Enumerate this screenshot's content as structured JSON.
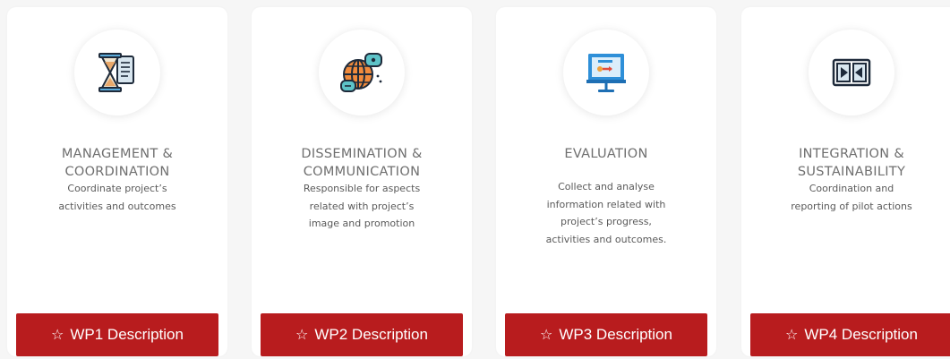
{
  "cards": [
    {
      "title": "MANAGEMENT &\nCOORDINATION",
      "title_line1": "MANAGEMENT &",
      "title_line2": "COORDINATION",
      "desc_line1": "Coordinate project’s",
      "desc_line2": "activities and outcomes",
      "button_label": "WP1 Description",
      "icon": "hourglass-document-icon"
    },
    {
      "title_line1": "DISSEMINATION &",
      "title_line2": "COMMUNICATION",
      "desc_line1": "Responsible for aspects",
      "desc_line2": "related with project’s",
      "desc_line3": "image and promotion",
      "button_label": "WP2 Description",
      "icon": "globe-chat-icon"
    },
    {
      "title_line1": "EVALUATION",
      "desc_line1": "Collect and analyse",
      "desc_line2": "information related with",
      "desc_line3": "project’s progress,",
      "desc_line4": "activities and outcomes.",
      "button_label": "WP3 Description",
      "icon": "presentation-board-icon"
    },
    {
      "title_line1": "INTEGRATION &",
      "title_line2": "SUSTAINABILITY",
      "desc_line1": "Coordination and",
      "desc_line2": "reporting of pilot actions",
      "button_label": "WP4 Description",
      "icon": "arrows-merge-icon"
    }
  ],
  "button_icon": "star-outline-icon",
  "colors": {
    "button_bg": "#b81c1e",
    "button_text": "#ffffff",
    "title_text": "#6f6f6f",
    "desc_text": "#5a5a5a",
    "card_bg": "#ffffff",
    "page_bg": "#f6f6f6"
  }
}
